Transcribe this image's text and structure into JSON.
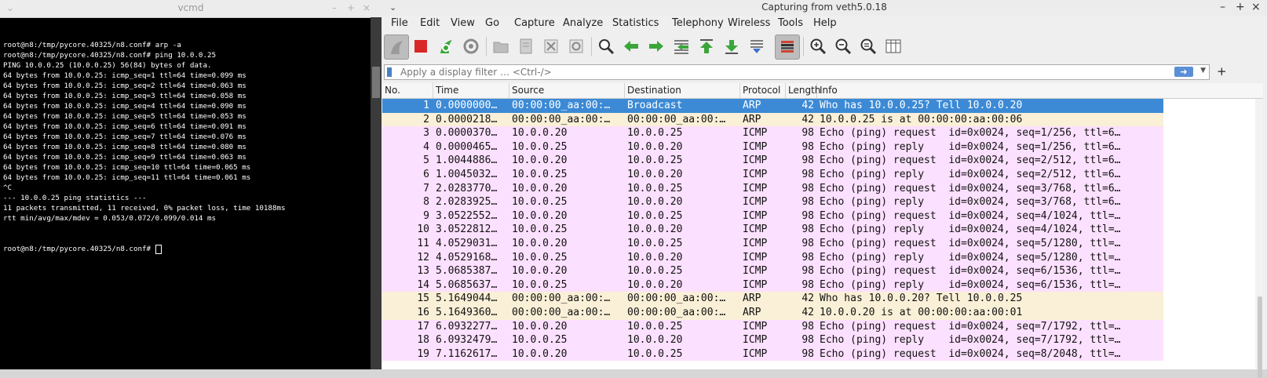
{
  "terminal": {
    "title": "vcmd",
    "lines": [
      "root@n8:/tmp/pycore.40325/n8.conf# arp -a",
      "root@n8:/tmp/pycore.40325/n8.conf# ping 10.0.0.25",
      "PING 10.0.0.25 (10.0.0.25) 56(84) bytes of data.",
      "64 bytes from 10.0.0.25: icmp_seq=1 ttl=64 time=0.099 ms",
      "64 bytes from 10.0.0.25: icmp_seq=2 ttl=64 time=0.063 ms",
      "64 bytes from 10.0.0.25: icmp_seq=3 ttl=64 time=0.058 ms",
      "64 bytes from 10.0.0.25: icmp_seq=4 ttl=64 time=0.090 ms",
      "64 bytes from 10.0.0.25: icmp_seq=5 ttl=64 time=0.053 ms",
      "64 bytes from 10.0.0.25: icmp_seq=6 ttl=64 time=0.091 ms",
      "64 bytes from 10.0.0.25: icmp_seq=7 ttl=64 time=0.076 ms",
      "64 bytes from 10.0.0.25: icmp_seq=8 ttl=64 time=0.080 ms",
      "64 bytes from 10.0.0.25: icmp_seq=9 ttl=64 time=0.063 ms",
      "64 bytes from 10.0.0.25: icmp_seq=10 ttl=64 time=0.065 ms",
      "64 bytes from 10.0.0.25: icmp_seq=11 ttl=64 time=0.061 ms",
      "^C",
      "--- 10.0.0.25 ping statistics ---",
      "11 packets transmitted, 11 received, 0% packet loss, time 10188ms",
      "rtt min/avg/max/mdev = 0.053/0.072/0.099/0.014 ms"
    ],
    "prompt": "root@n8:/tmp/pycore.40325/n8.conf# "
  },
  "wireshark": {
    "title": "Capturing from veth5.0.18",
    "menu": [
      "File",
      "Edit",
      "View",
      "Go",
      "Capture",
      "Analyze",
      "Statistics",
      "Telephony",
      "Wireless",
      "Tools",
      "Help"
    ],
    "toolbar": [
      {
        "name": "start-capture-icon",
        "active": true
      },
      {
        "name": "stop-capture-icon",
        "color": "#d92727"
      },
      {
        "name": "restart-capture-icon",
        "color": "#3aa63a"
      },
      {
        "name": "capture-options-icon"
      },
      {
        "name": "open-file-icon"
      },
      {
        "name": "save-file-icon"
      },
      {
        "name": "close-file-icon"
      },
      {
        "name": "reload-file-icon"
      },
      {
        "name": "find-packet-icon"
      },
      {
        "name": "go-back-icon",
        "color": "#3aa63a"
      },
      {
        "name": "go-forward-icon",
        "color": "#3aa63a"
      },
      {
        "name": "go-to-packet-icon",
        "color": "#3aa63a"
      },
      {
        "name": "go-first-packet-icon",
        "color": "#3aa63a"
      },
      {
        "name": "go-last-packet-icon",
        "color": "#3aa63a"
      },
      {
        "name": "autoscroll-icon",
        "color": "#3c6fd1"
      },
      {
        "name": "colorize-icon",
        "active": true
      },
      {
        "name": "zoom-in-icon"
      },
      {
        "name": "zoom-out-icon"
      },
      {
        "name": "normal-size-icon"
      },
      {
        "name": "resize-columns-icon"
      }
    ],
    "filter": {
      "placeholder": "Apply a display filter … <Ctrl-/>"
    },
    "columns": [
      "No.",
      "Time",
      "Source",
      "Destination",
      "Protocol",
      "Length",
      "Info"
    ],
    "packets": [
      {
        "no": "1",
        "time": "0.0000000…",
        "src": "00:00:00_aa:00:…",
        "dst": "Broadcast",
        "proto": "ARP",
        "len": "42",
        "info": "Who has 10.0.0.25? Tell 10.0.0.20",
        "kind": "sel"
      },
      {
        "no": "2",
        "time": "0.0000218…",
        "src": "00:00:00_aa:00:…",
        "dst": "00:00:00_aa:00:…",
        "proto": "ARP",
        "len": "42",
        "info": "10.0.0.25 is at 00:00:00:aa:00:06",
        "kind": "arp"
      },
      {
        "no": "3",
        "time": "0.0000370…",
        "src": "10.0.0.20",
        "dst": "10.0.0.25",
        "proto": "ICMP",
        "len": "98",
        "info": "Echo (ping) request  id=0x0024, seq=1/256, ttl=6…",
        "kind": "icmp"
      },
      {
        "no": "4",
        "time": "0.0000465…",
        "src": "10.0.0.25",
        "dst": "10.0.0.20",
        "proto": "ICMP",
        "len": "98",
        "info": "Echo (ping) reply    id=0x0024, seq=1/256, ttl=6…",
        "kind": "icmp"
      },
      {
        "no": "5",
        "time": "1.0044886…",
        "src": "10.0.0.20",
        "dst": "10.0.0.25",
        "proto": "ICMP",
        "len": "98",
        "info": "Echo (ping) request  id=0x0024, seq=2/512, ttl=6…",
        "kind": "icmp"
      },
      {
        "no": "6",
        "time": "1.0045032…",
        "src": "10.0.0.25",
        "dst": "10.0.0.20",
        "proto": "ICMP",
        "len": "98",
        "info": "Echo (ping) reply    id=0x0024, seq=2/512, ttl=6…",
        "kind": "icmp"
      },
      {
        "no": "7",
        "time": "2.0283770…",
        "src": "10.0.0.20",
        "dst": "10.0.0.25",
        "proto": "ICMP",
        "len": "98",
        "info": "Echo (ping) request  id=0x0024, seq=3/768, ttl=6…",
        "kind": "icmp"
      },
      {
        "no": "8",
        "time": "2.0283925…",
        "src": "10.0.0.25",
        "dst": "10.0.0.20",
        "proto": "ICMP",
        "len": "98",
        "info": "Echo (ping) reply    id=0x0024, seq=3/768, ttl=6…",
        "kind": "icmp"
      },
      {
        "no": "9",
        "time": "3.0522552…",
        "src": "10.0.0.20",
        "dst": "10.0.0.25",
        "proto": "ICMP",
        "len": "98",
        "info": "Echo (ping) request  id=0x0024, seq=4/1024, ttl=…",
        "kind": "icmp"
      },
      {
        "no": "10",
        "time": "3.0522812…",
        "src": "10.0.0.25",
        "dst": "10.0.0.20",
        "proto": "ICMP",
        "len": "98",
        "info": "Echo (ping) reply    id=0x0024, seq=4/1024, ttl=…",
        "kind": "icmp"
      },
      {
        "no": "11",
        "time": "4.0529031…",
        "src": "10.0.0.20",
        "dst": "10.0.0.25",
        "proto": "ICMP",
        "len": "98",
        "info": "Echo (ping) request  id=0x0024, seq=5/1280, ttl=…",
        "kind": "icmp"
      },
      {
        "no": "12",
        "time": "4.0529168…",
        "src": "10.0.0.25",
        "dst": "10.0.0.20",
        "proto": "ICMP",
        "len": "98",
        "info": "Echo (ping) reply    id=0x0024, seq=5/1280, ttl=…",
        "kind": "icmp"
      },
      {
        "no": "13",
        "time": "5.0685387…",
        "src": "10.0.0.20",
        "dst": "10.0.0.25",
        "proto": "ICMP",
        "len": "98",
        "info": "Echo (ping) request  id=0x0024, seq=6/1536, ttl=…",
        "kind": "icmp"
      },
      {
        "no": "14",
        "time": "5.0685637…",
        "src": "10.0.0.25",
        "dst": "10.0.0.20",
        "proto": "ICMP",
        "len": "98",
        "info": "Echo (ping) reply    id=0x0024, seq=6/1536, ttl=…",
        "kind": "icmp"
      },
      {
        "no": "15",
        "time": "5.1649044…",
        "src": "00:00:00_aa:00:…",
        "dst": "00:00:00_aa:00:…",
        "proto": "ARP",
        "len": "42",
        "info": "Who has 10.0.0.20? Tell 10.0.0.25",
        "kind": "arp"
      },
      {
        "no": "16",
        "time": "5.1649360…",
        "src": "00:00:00_aa:00:…",
        "dst": "00:00:00_aa:00:…",
        "proto": "ARP",
        "len": "42",
        "info": "10.0.0.20 is at 00:00:00:aa:00:01",
        "kind": "arp"
      },
      {
        "no": "17",
        "time": "6.0932277…",
        "src": "10.0.0.20",
        "dst": "10.0.0.25",
        "proto": "ICMP",
        "len": "98",
        "info": "Echo (ping) request  id=0x0024, seq=7/1792, ttl=…",
        "kind": "icmp"
      },
      {
        "no": "18",
        "time": "6.0932479…",
        "src": "10.0.0.25",
        "dst": "10.0.0.20",
        "proto": "ICMP",
        "len": "98",
        "info": "Echo (ping) reply    id=0x0024, seq=7/1792, ttl=…",
        "kind": "icmp"
      },
      {
        "no": "19",
        "time": "7.1162617…",
        "src": "10.0.0.20",
        "dst": "10.0.0.25",
        "proto": "ICMP",
        "len": "98",
        "info": "Echo (ping) request  id=0x0024, seq=8/2048, ttl=…",
        "kind": "icmp"
      }
    ]
  }
}
